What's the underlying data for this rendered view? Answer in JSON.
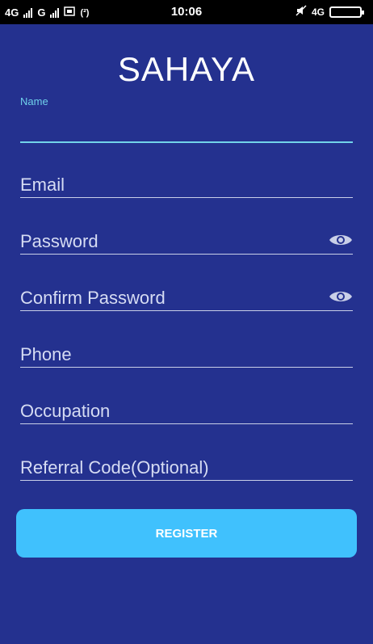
{
  "status_bar": {
    "network_left": "4G",
    "network_right": "G",
    "extra_icon": "(²)",
    "time": "10:06",
    "network_badge": "4G",
    "icons": [
      "signal-bars-icon",
      "screenshot-icon",
      "wifi-hotspot-icon",
      "mute-icon",
      "battery-icon"
    ]
  },
  "app": {
    "title": "SAHAYA"
  },
  "form": {
    "name": {
      "label": "Name",
      "value": ""
    },
    "email": {
      "placeholder": "Email"
    },
    "password": {
      "placeholder": "Password",
      "toggle_icon": "eye-icon"
    },
    "confirm_password": {
      "placeholder": "Confirm Password",
      "toggle_icon": "eye-icon"
    },
    "phone": {
      "placeholder": "Phone"
    },
    "occupation": {
      "placeholder": "Occupation"
    },
    "referral": {
      "placeholder": "Referral Code(Optional)"
    },
    "register_label": "REGISTER"
  },
  "colors": {
    "background": "#24318f",
    "accent": "#40c1fd",
    "focus": "#72d3ea",
    "status_bar": "#000000"
  }
}
